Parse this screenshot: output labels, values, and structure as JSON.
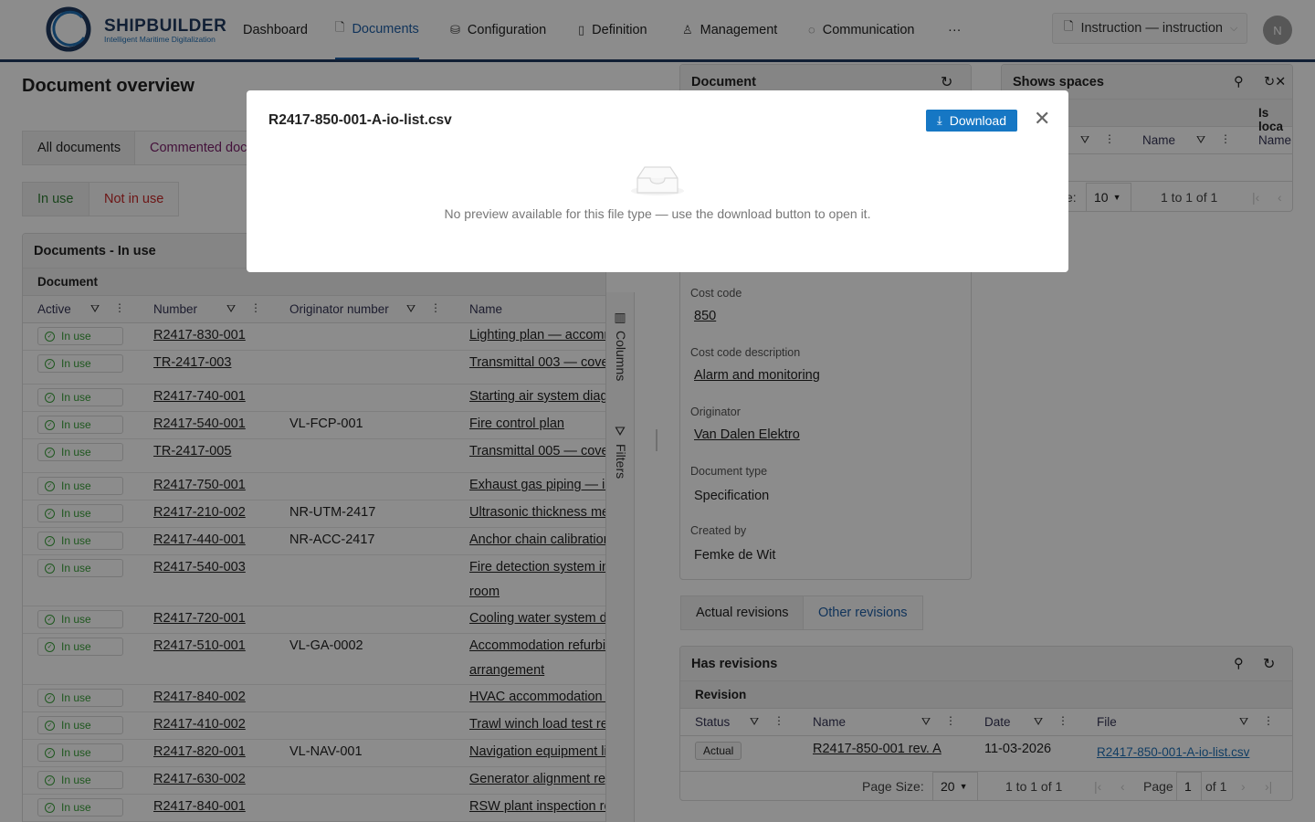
{
  "app": {
    "brand": "SHIPBUILDER",
    "tagline": "Intelligent Maritime Digitalization",
    "avatar": "N",
    "instruction": "Instruction — instruction"
  },
  "nav": [
    {
      "label": "Dashboard"
    },
    {
      "label": "Documents"
    },
    {
      "label": "Configuration"
    },
    {
      "label": "Definition"
    },
    {
      "label": "Management"
    },
    {
      "label": "Communication"
    },
    {
      "label": "···"
    }
  ],
  "page": {
    "title": "Document overview"
  },
  "tabs": {
    "all": "All documents",
    "commented": "Commented docu"
  },
  "subtabs": {
    "inuse": "In use",
    "notinuse": "Not in use"
  },
  "grid": {
    "title": "Documents - In use",
    "group": "Document",
    "columns": [
      "Active",
      "Number",
      "Originator number",
      "Name"
    ],
    "rows": [
      {
        "active": "In use",
        "number": "R2417-830-001",
        "orig": "",
        "name": "Lighting plan — accomm"
      },
      {
        "active": "In use",
        "number": "TR-2417-003",
        "orig": "",
        "name": "Transmittal 003 — cove"
      },
      {
        "active": "In use",
        "number": "R2417-740-001",
        "orig": "",
        "name": "Starting air system diag"
      },
      {
        "active": "In use",
        "number": "R2417-540-001",
        "orig": "VL-FCP-001",
        "name": "Fire control plan"
      },
      {
        "active": "In use",
        "number": "TR-2417-005",
        "orig": "",
        "name": "Transmittal 005 — cove"
      },
      {
        "active": "In use",
        "number": "R2417-750-001",
        "orig": "",
        "name": "Exhaust gas piping — in"
      },
      {
        "active": "In use",
        "number": "R2417-210-002",
        "orig": "NR-UTM-2417",
        "name": "Ultrasonic thickness me"
      },
      {
        "active": "In use",
        "number": "R2417-440-001",
        "orig": "NR-ACC-2417",
        "name": "Anchor chain calibration"
      },
      {
        "active": "In use",
        "number": "R2417-540-003",
        "orig": "",
        "name": "Fire detection system in",
        "name2": "room"
      },
      {
        "active": "In use",
        "number": "R2417-720-001",
        "orig": "",
        "name": "Cooling water system di"
      },
      {
        "active": "In use",
        "number": "R2417-510-001",
        "orig": "VL-GA-0002",
        "name": "Accommodation refurbis",
        "name2": "arrangement"
      },
      {
        "active": "In use",
        "number": "R2417-840-002",
        "orig": "",
        "name": "HVAC accommodation -"
      },
      {
        "active": "In use",
        "number": "R2417-410-002",
        "orig": "",
        "name": "Trawl winch load test re"
      },
      {
        "active": "In use",
        "number": "R2417-820-001",
        "orig": "VL-NAV-001",
        "name": "Navigation equipment lis"
      },
      {
        "active": "In use",
        "number": "R2417-630-002",
        "orig": "",
        "name": "Generator alignment rep"
      },
      {
        "active": "In use",
        "number": "R2417-840-001",
        "orig": "",
        "name": "RSW plant inspection re"
      }
    ]
  },
  "sidebar": {
    "columns": "Columns",
    "filters": "Filters"
  },
  "document_panel": {
    "title": "Document",
    "fields": [
      {
        "label": "Cost code",
        "value": "850"
      },
      {
        "label": "Cost code description",
        "value": "Alarm and monitoring"
      },
      {
        "label": "Originator",
        "value": "Van Dalen Elektro"
      },
      {
        "label": "Document type",
        "value": "Specification"
      },
      {
        "label": "Created by",
        "value": "Femke de Wit"
      }
    ]
  },
  "spaces_panel": {
    "title": "Shows spaces",
    "col_islocal": "Is loca",
    "col_name": "Name",
    "col_name2": "Name",
    "page_size_label": "e:",
    "page_size": "10",
    "range": "1 to 1 of 1"
  },
  "revision_tabs": {
    "actual": "Actual revisions",
    "other": "Other revisions"
  },
  "revisions": {
    "title": "Has revisions",
    "group": "Revision",
    "columns": [
      "Status",
      "Name",
      "Date",
      "File"
    ],
    "rows": [
      {
        "status": "Actual",
        "name": "R2417-850-001 rev. A",
        "date": "11-03-2026",
        "file": "R2417-850-001-A-io-list.csv"
      }
    ],
    "page_size_label": "Page Size:",
    "page_size": "20",
    "range": "1 to 1 of 1",
    "page_label": "Page",
    "page": "1",
    "of": "of 1"
  },
  "modal": {
    "title": "R2417-850-001-A-io-list.csv",
    "download": "Download",
    "empty": "No preview available for this file type — use the download button to open it."
  },
  "colors": {
    "navy": "#1f3a5f",
    "primary": "#1677c4",
    "green": "#3aa03a",
    "red": "#c62828",
    "purple": "#7b1f6a"
  }
}
